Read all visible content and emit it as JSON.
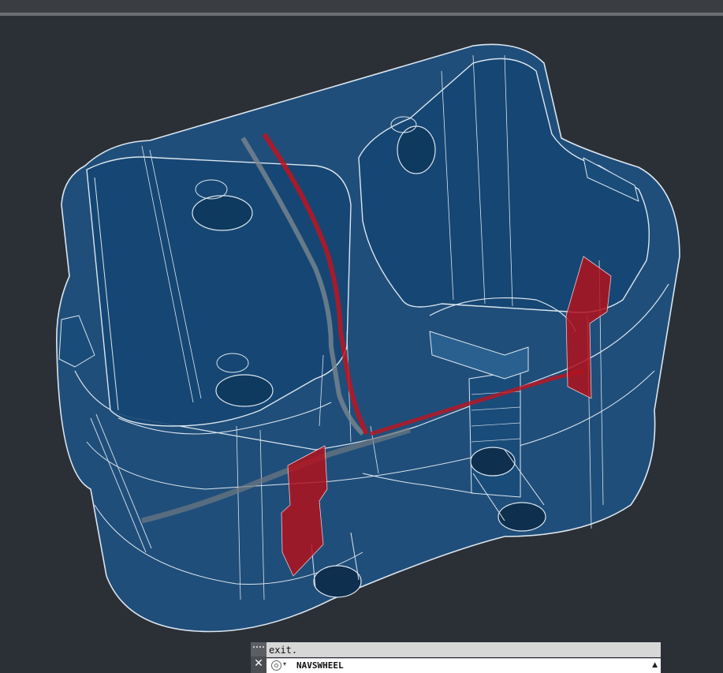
{
  "command_line": {
    "history_text": "exit.",
    "input_text": "NAVSWHEEL",
    "close_symbol": "✕",
    "history_toggle_symbol": "▲",
    "recent_dropdown_symbol": "▾"
  },
  "viewport": {
    "background_color": "#2b2f36",
    "model_fill_color": "#1e5486",
    "edge_color": "#dbe6ef",
    "highlight_color": "#c0141e"
  }
}
